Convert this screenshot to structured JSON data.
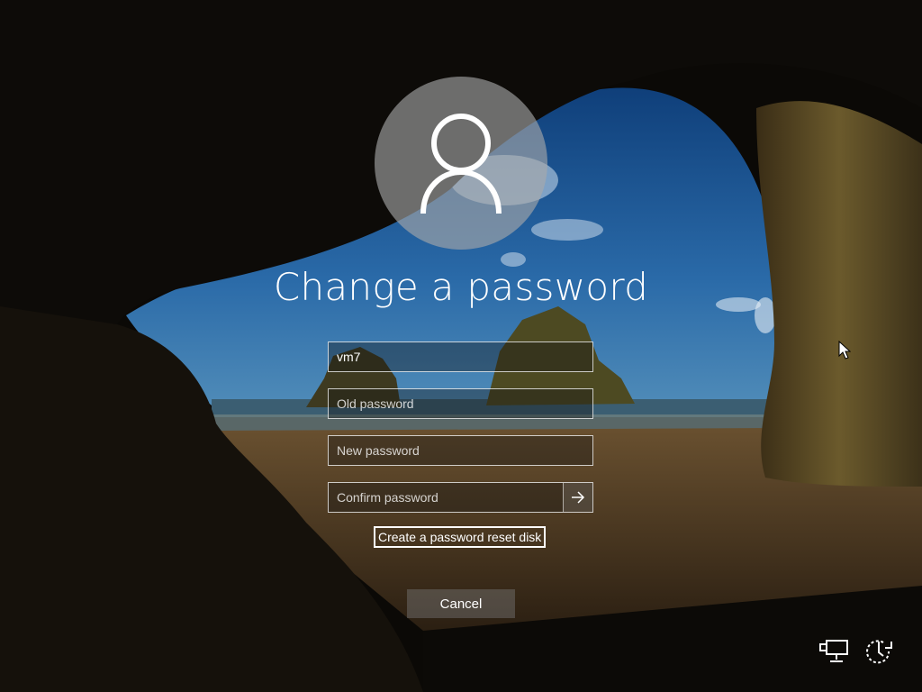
{
  "screen": {
    "title": "Change a password"
  },
  "form": {
    "username": {
      "value": "vm7"
    },
    "old_password": {
      "placeholder": "Old password"
    },
    "new_password": {
      "placeholder": "New password"
    },
    "confirm_password": {
      "placeholder": "Confirm password"
    },
    "submit_icon": "arrow-right-icon"
  },
  "links": {
    "reset_disk_label": "Create a password reset disk"
  },
  "buttons": {
    "cancel_label": "Cancel"
  },
  "tray": {
    "network_icon": "network-icon",
    "power_icon": "power-icon"
  },
  "avatar_icon": "user-icon",
  "colors": {
    "accent": "#ffffff",
    "field_border": "#d8d8d8",
    "avatar_bg": "#9a9a9a"
  }
}
